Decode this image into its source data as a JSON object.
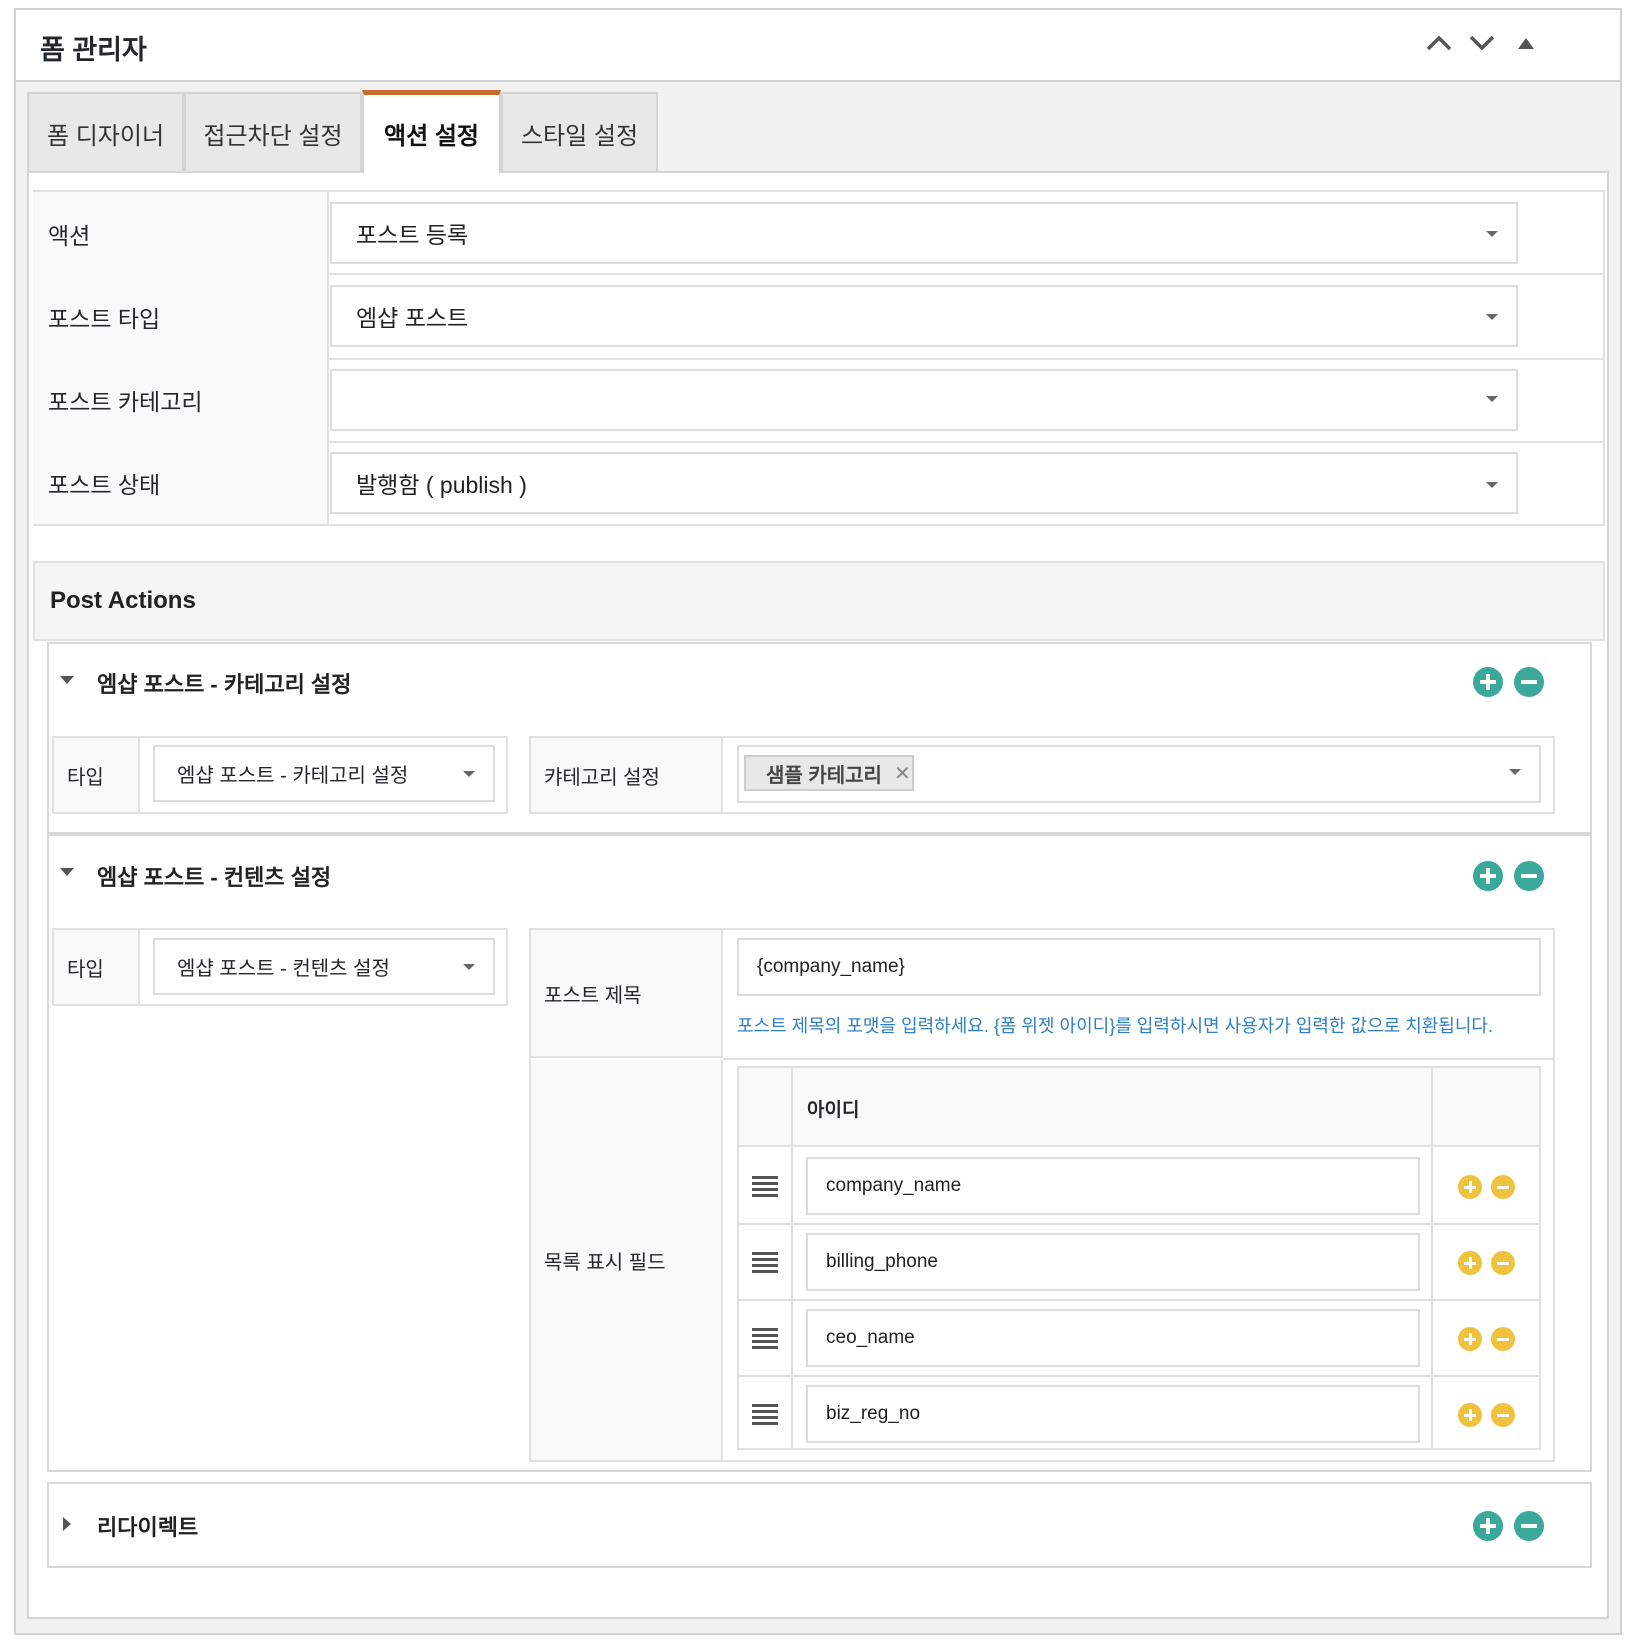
{
  "panel": {
    "title": "폼 관리자"
  },
  "tabs": [
    {
      "label": "폼 디자이너"
    },
    {
      "label": "접근차단 설정"
    },
    {
      "label": "액션 설정"
    },
    {
      "label": "스타일 설정"
    }
  ],
  "settings": {
    "action": {
      "label": "액션",
      "value": "포스트 등록"
    },
    "post_type": {
      "label": "포스트 타입",
      "value": "엠샵 포스트"
    },
    "post_category": {
      "label": "포스트 카테고리",
      "value": ""
    },
    "post_status": {
      "label": "포스트 상태",
      "value": "발행함 ( publish )"
    }
  },
  "post_actions": {
    "title": "Post Actions",
    "category_section": {
      "title": "엠샵 포스트 - 카테고리 설정",
      "type_label": "타입",
      "type_value": "엠샵 포스트 - 카테고리 설정",
      "category_label": "캬테고리 설정",
      "tag": "샘플 카테고리"
    },
    "content_section": {
      "title": "엠샵 포스트 - 컨텐츠 설정",
      "type_label": "타입",
      "type_value": "엠샵 포스트 - 컨텐츠 설정",
      "post_title_label": "포스트 제목",
      "post_title_value": "{company_name}",
      "post_title_hint": "포스트 제목의 포맷을 입력하세요. {폼 위젯 아이디}를 입력하시면 사용자가 입력한 값으로 치환됩니다.",
      "list_fields_label": "목록 표시 필드",
      "id_header": "아이디",
      "fields": [
        {
          "value": "company_name"
        },
        {
          "value": "billing_phone"
        },
        {
          "value": "ceo_name"
        },
        {
          "value": "biz_reg_no"
        }
      ]
    },
    "redirect_section": {
      "title": "리다이렉트"
    }
  },
  "colors": {
    "accent_tab": "#c8692f",
    "teal": "#3aa99c",
    "yellow": "#efc13c",
    "hint": "#2e7fc6"
  },
  "icons": {
    "header": [
      "chevron-up-icon",
      "chevron-down-icon",
      "triangle-up-icon"
    ],
    "add": "plus-circle-icon",
    "remove": "minus-circle-icon",
    "drag": "drag-handle-icon",
    "tag_remove": "close-icon"
  }
}
